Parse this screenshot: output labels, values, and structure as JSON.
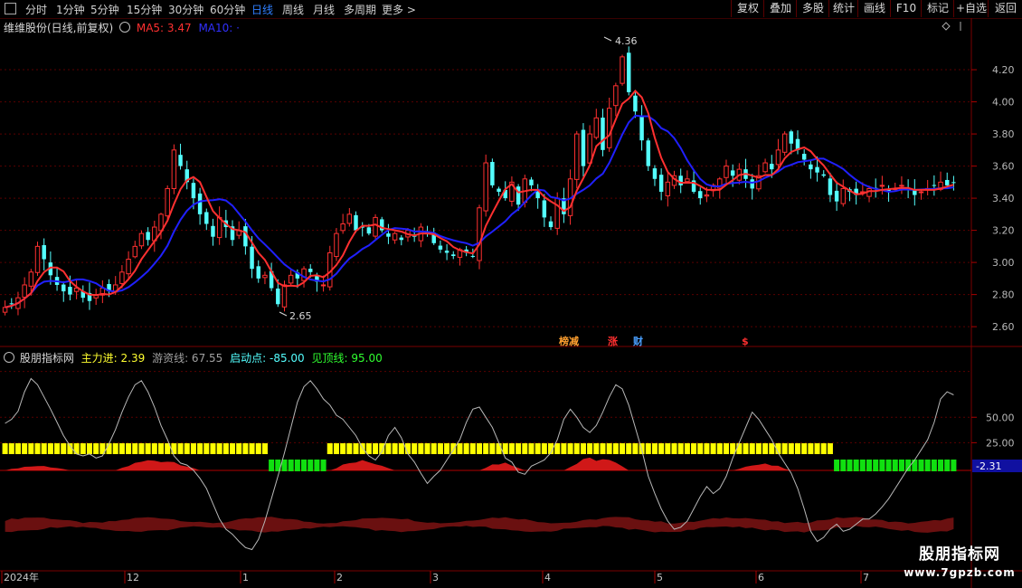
{
  "toolbar": {
    "timeframes": [
      "分时",
      "1分钟",
      "5分钟",
      "15分钟",
      "30分钟",
      "60分钟",
      "日线",
      "周线",
      "月线",
      "多周期",
      "更多 >"
    ],
    "active_timeframe": "日线",
    "buttons": [
      "复权",
      "叠加",
      "多股",
      "统计",
      "画线",
      "F10",
      "标记",
      "+自选",
      "返回"
    ]
  },
  "main_panel": {
    "title": "维维股份(日线,前复权)",
    "ma5_label": "MA5: 3.47",
    "ma10_label": "MA10: ·",
    "ma5_color": "#ff3030",
    "ma10_color": "#2020ff",
    "markers": [
      "榜减",
      "涨",
      "财",
      "$"
    ]
  },
  "indicator_panel": {
    "title": "股朋指标网",
    "main_in": "主力进: 2.39",
    "hot_money": "游资线: 67.55",
    "start_point": "启动点: -85.00",
    "top_line": "见顶线: 95.00",
    "current_value": "-2.31"
  },
  "watermark": {
    "title": "股朋指标网",
    "url": "www.7gpzb.com"
  },
  "chart_data": [
    {
      "type": "candlestick",
      "title": "维维股份(日线,前复权)",
      "y_ticks": [
        "4.20",
        "4.00",
        "3.80",
        "3.60",
        "3.40",
        "3.20",
        "3.00",
        "2.80",
        "2.60"
      ],
      "ylim": [
        2.55,
        4.42
      ],
      "annotations": [
        "4.36",
        "2.65"
      ],
      "up_color": "#ff3030",
      "down_color": "#54ffff",
      "closes": [
        2.72,
        2.74,
        2.78,
        2.86,
        2.94,
        3.1,
        3.02,
        2.92,
        2.86,
        2.82,
        2.8,
        2.84,
        2.78,
        2.76,
        2.8,
        2.84,
        2.82,
        2.86,
        2.94,
        3.02,
        3.1,
        3.18,
        3.14,
        3.22,
        3.3,
        3.46,
        3.7,
        3.6,
        3.5,
        3.4,
        3.3,
        3.24,
        3.16,
        3.28,
        3.22,
        3.14,
        3.2,
        3.1,
        2.96,
        2.9,
        2.92,
        2.84,
        2.74,
        2.86,
        2.92,
        2.9,
        2.96,
        2.94,
        2.88,
        2.86,
        3.06,
        3.18,
        3.24,
        3.3,
        3.2,
        3.22,
        3.18,
        3.28,
        3.2,
        3.16,
        3.18,
        3.14,
        3.2,
        3.16,
        3.22,
        3.18,
        3.12,
        3.08,
        3.06,
        3.04,
        3.08,
        3.06,
        3.04,
        3.34,
        3.62,
        3.48,
        3.44,
        3.4,
        3.5,
        3.36,
        3.52,
        3.48,
        3.4,
        3.28,
        3.22,
        3.4,
        3.3,
        3.52,
        3.8,
        3.6,
        3.8,
        3.9,
        3.7,
        3.96,
        4.1,
        4.28,
        4.06,
        3.94,
        3.76,
        3.6,
        3.52,
        3.44,
        3.5,
        3.54,
        3.48,
        3.52,
        3.44,
        3.4,
        3.42,
        3.48,
        3.52,
        3.6,
        3.54,
        3.58,
        3.52,
        3.46,
        3.54,
        3.62,
        3.58,
        3.7,
        3.8,
        3.74,
        3.7,
        3.64,
        3.58,
        3.56,
        3.54,
        3.42,
        3.38,
        3.46,
        3.44,
        3.42,
        3.44,
        3.46,
        3.46,
        3.48,
        3.44,
        3.46,
        3.48,
        3.46,
        3.42,
        3.44,
        3.46,
        3.48,
        3.5,
        3.48,
        3.5
      ]
    },
    {
      "type": "line",
      "title": "股朋指标网",
      "y_ticks": [
        "50.00",
        "25.00"
      ],
      "series": [
        {
          "name": "主力进",
          "value": 2.39
        },
        {
          "name": "游资线",
          "value": 67.55
        },
        {
          "name": "启动点",
          "value": -85.0
        },
        {
          "name": "见顶线",
          "value": 95.0
        }
      ],
      "x_ticks": [
        "2024年",
        "12",
        "1",
        "2",
        "3",
        "4",
        "5",
        "6",
        "7"
      ],
      "line_values": [
        44,
        48,
        56,
        75,
        88,
        82,
        70,
        58,
        45,
        32,
        22,
        14,
        12,
        14,
        10,
        12,
        24,
        38,
        55,
        70,
        82,
        86,
        75,
        60,
        42,
        28,
        12,
        5,
        3,
        -2,
        -10,
        -20,
        -35,
        -50,
        -60,
        -65,
        -72,
        -78,
        -80,
        -70,
        -52,
        -30,
        -8,
        15,
        40,
        65,
        80,
        86,
        78,
        68,
        62,
        52,
        48,
        40,
        32,
        20,
        12,
        8,
        16,
        32,
        40,
        30,
        14,
        6,
        -5,
        -15,
        -8,
        -2,
        8,
        18,
        28,
        45,
        58,
        60,
        50,
        40,
        25,
        10,
        6,
        -4,
        -6,
        2,
        5,
        8,
        15,
        28,
        48,
        58,
        50,
        40,
        35,
        42,
        55,
        70,
        82,
        78,
        62,
        40,
        18,
        -8,
        -25,
        -40,
        -52,
        -60,
        -58,
        -52,
        -40,
        -28,
        -18,
        -25,
        -20,
        -8,
        10,
        25,
        40,
        55,
        48,
        38,
        28,
        15,
        5,
        -5,
        -20,
        -40,
        -62,
        -72,
        -68,
        -60,
        -55,
        -62,
        -60,
        -55,
        -50,
        -50,
        -45,
        -38,
        -30,
        -20,
        -10,
        0,
        8,
        18,
        28,
        45,
        68,
        75,
        72
      ]
    }
  ]
}
